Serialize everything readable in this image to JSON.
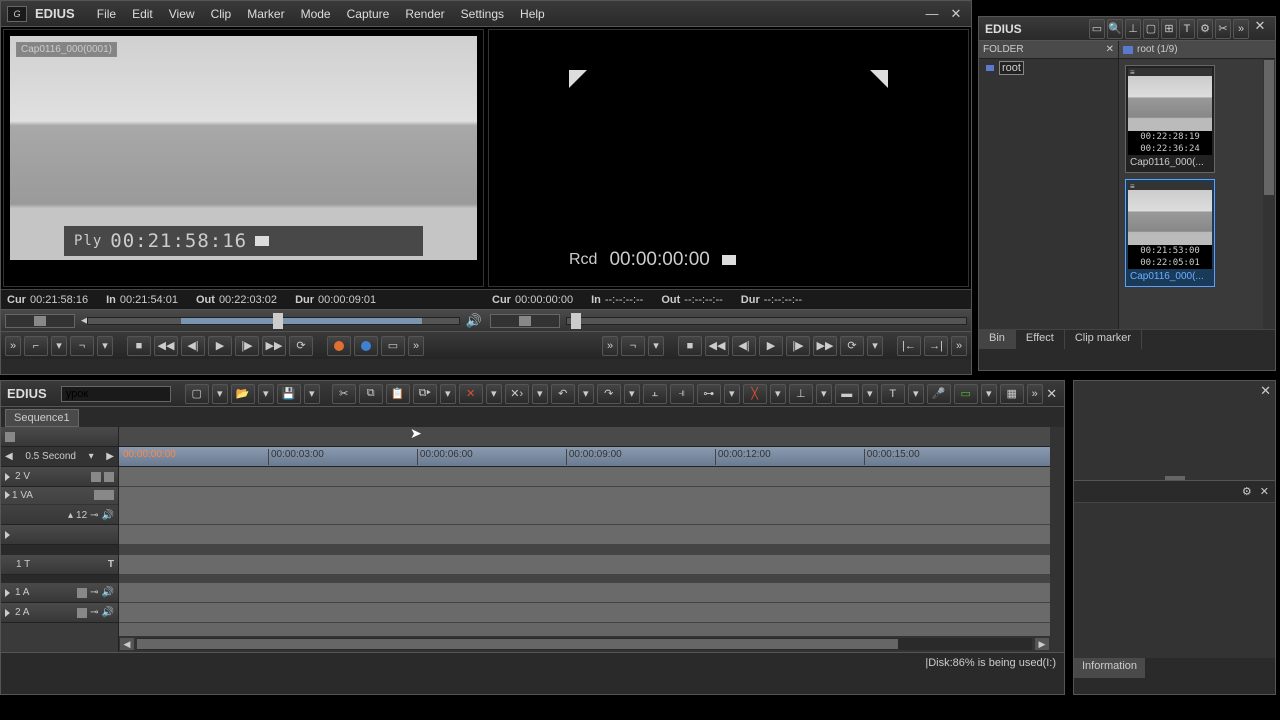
{
  "app": {
    "name": "EDIUS"
  },
  "menu": [
    "File",
    "Edit",
    "View",
    "Clip",
    "Marker",
    "Mode",
    "Capture",
    "Render",
    "Settings",
    "Help"
  ],
  "source_monitor": {
    "clip_label": "Cap0116_000(0001)",
    "overlay_prefix": "Ply",
    "overlay_tc": "00:21:58:16",
    "tc": {
      "cur_l": "Cur",
      "cur": "00:21:58:16",
      "in_l": "In",
      "in": "00:21:54:01",
      "out_l": "Out",
      "out": "00:22:03:02",
      "dur_l": "Dur",
      "dur": "00:00:09:01"
    }
  },
  "record_monitor": {
    "overlay_prefix": "Rcd",
    "overlay_tc": "00:00:00:00",
    "tc": {
      "cur_l": "Cur",
      "cur": "00:00:00:00",
      "in_l": "In",
      "in": "--:--:--:--",
      "out_l": "Out",
      "out": "--:--:--:--",
      "dur_l": "Dur",
      "dur": "--:--:--:--"
    }
  },
  "timeline": {
    "app": "EDIUS",
    "seq_input": "урок",
    "sequence_tab": "Sequence1",
    "zoom": "0.5 Second",
    "ruler": [
      "00:00:00:00",
      "00:00:03:00",
      "00:00:06:00",
      "00:00:09:00",
      "00:00:12:00",
      "00:00:15:00"
    ],
    "tracks": {
      "v2": "2 V",
      "va1": "1 VA",
      "va1_sub": "12",
      "t1": "1 T",
      "a1": "1 A",
      "a2": "2 A"
    },
    "status": "Disk:86% is being used(I:)"
  },
  "bin": {
    "title": "EDIUS",
    "folder_header": "FOLDER",
    "root_name": "root",
    "clips_header": "root (1/9)",
    "clip1": {
      "name": "Cap0116_000(...",
      "tc1": "00:22:28:19",
      "tc2": "00:22:36:24"
    },
    "clip2": {
      "name": "Cap0116_000(...",
      "tc1": "00:21:53:00",
      "tc2": "00:22:05:01"
    },
    "tabs": {
      "bin": "Bin",
      "effect": "Effect",
      "marker": "Clip marker"
    }
  },
  "info": {
    "tab": "Information"
  }
}
